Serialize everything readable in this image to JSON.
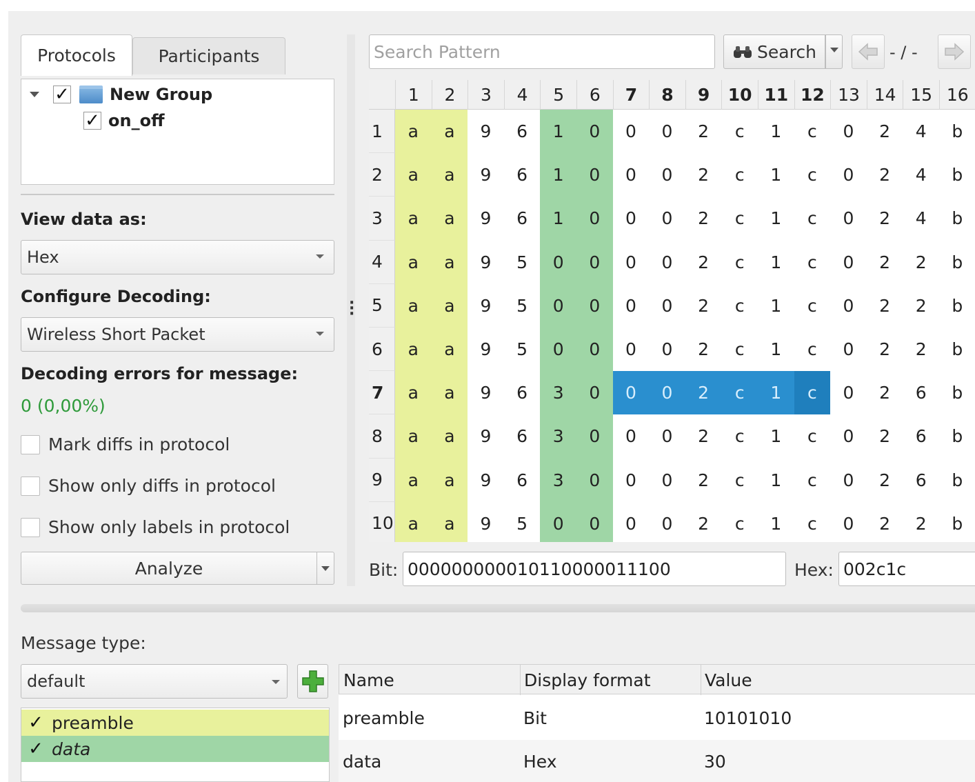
{
  "tabs": [
    "Protocols",
    "Participants"
  ],
  "tree": {
    "group_label": "New Group",
    "protocol_label": "on_off"
  },
  "view_data_as": {
    "label": "View data as:",
    "value": "Hex"
  },
  "configure_decoding": {
    "label": "Configure Decoding:",
    "value": "Wireless Short Packet"
  },
  "decoding_errors": {
    "label": "Decoding errors for message:",
    "value": "0 (0,00%)"
  },
  "checkboxes": [
    "Mark diffs in protocol",
    "Show only diffs in protocol",
    "Show only labels in protocol"
  ],
  "analyze_label": "Analyze",
  "search": {
    "placeholder": "Search Pattern",
    "button_label": "Search",
    "nav_text": "- / -"
  },
  "grid": {
    "columns": [
      "1",
      "2",
      "3",
      "4",
      "5",
      "6",
      "7",
      "8",
      "9",
      "10",
      "11",
      "12",
      "13",
      "14",
      "15",
      "16"
    ],
    "bold_columns": [
      7,
      8,
      9,
      10,
      11,
      12
    ],
    "selected_row": 7,
    "selected_cols": [
      7,
      8,
      9,
      10,
      11,
      12
    ],
    "rows": [
      {
        "label": "1",
        "cells": [
          "a",
          "a",
          "9",
          "6",
          "1",
          "0",
          "0",
          "0",
          "2",
          "c",
          "1",
          "c",
          "0",
          "2",
          "4",
          "b"
        ]
      },
      {
        "label": "2",
        "cells": [
          "a",
          "a",
          "9",
          "6",
          "1",
          "0",
          "0",
          "0",
          "2",
          "c",
          "1",
          "c",
          "0",
          "2",
          "4",
          "b"
        ]
      },
      {
        "label": "3",
        "cells": [
          "a",
          "a",
          "9",
          "6",
          "1",
          "0",
          "0",
          "0",
          "2",
          "c",
          "1",
          "c",
          "0",
          "2",
          "4",
          "b"
        ]
      },
      {
        "label": "4",
        "cells": [
          "a",
          "a",
          "9",
          "5",
          "0",
          "0",
          "0",
          "0",
          "2",
          "c",
          "1",
          "c",
          "0",
          "2",
          "2",
          "b"
        ]
      },
      {
        "label": "5",
        "cells": [
          "a",
          "a",
          "9",
          "5",
          "0",
          "0",
          "0",
          "0",
          "2",
          "c",
          "1",
          "c",
          "0",
          "2",
          "2",
          "b"
        ]
      },
      {
        "label": "6",
        "cells": [
          "a",
          "a",
          "9",
          "5",
          "0",
          "0",
          "0",
          "0",
          "2",
          "c",
          "1",
          "c",
          "0",
          "2",
          "2",
          "b"
        ]
      },
      {
        "label": "7",
        "cells": [
          "a",
          "a",
          "9",
          "6",
          "3",
          "0",
          "0",
          "0",
          "2",
          "c",
          "1",
          "c",
          "0",
          "2",
          "6",
          "b"
        ]
      },
      {
        "label": "8",
        "cells": [
          "a",
          "a",
          "9",
          "6",
          "3",
          "0",
          "0",
          "0",
          "2",
          "c",
          "1",
          "c",
          "0",
          "2",
          "6",
          "b"
        ]
      },
      {
        "label": "9",
        "cells": [
          "a",
          "a",
          "9",
          "6",
          "3",
          "0",
          "0",
          "0",
          "2",
          "c",
          "1",
          "c",
          "0",
          "2",
          "6",
          "b"
        ]
      },
      {
        "label": "10",
        "cells": [
          "a",
          "a",
          "9",
          "5",
          "0",
          "0",
          "0",
          "0",
          "2",
          "c",
          "1",
          "c",
          "0",
          "2",
          "2",
          "b"
        ]
      }
    ],
    "label_colors": {
      "preamble": "#e8f19c",
      "data": "#9fd6a6",
      "selection": "#2a8fcf"
    }
  },
  "bit": {
    "label": "Bit:",
    "value": "000000000010110000011100"
  },
  "hex": {
    "label": "Hex:",
    "value": "002c1c"
  },
  "message_type": {
    "label": "Message type:",
    "value": "default"
  },
  "labels_list": [
    {
      "name": "preamble",
      "color": "#e8f19c",
      "italic": false
    },
    {
      "name": "data",
      "color": "#9fd6a6",
      "italic": true
    }
  ],
  "properties_table": {
    "headers": [
      "Name",
      "Display format",
      "Value"
    ],
    "rows": [
      {
        "name": "preamble",
        "format": "Bit",
        "value": "10101010"
      },
      {
        "name": "data",
        "format": "Hex",
        "value": "30"
      }
    ]
  }
}
